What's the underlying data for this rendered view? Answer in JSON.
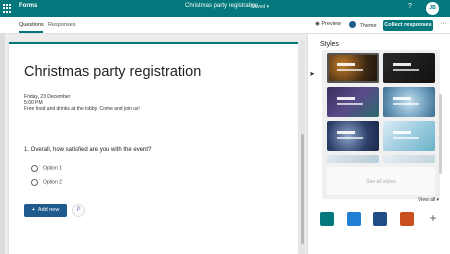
{
  "topbar": {
    "app_name": "Forms",
    "doc_title": "Christmas party registration",
    "saved": "Saved",
    "help": "?",
    "avatar": "JB",
    "color": "#03787c"
  },
  "cmdbar": {
    "tabs": [
      {
        "label": "Questions"
      },
      {
        "label": "Responses"
      }
    ],
    "preview": "Preview",
    "theme": "Theme",
    "collect": "Collect responses",
    "more": "···"
  },
  "form": {
    "title": "Christmas party registration",
    "date": "Friday, 23 December",
    "time": "5:00 PM",
    "description": "Free food and drinks at the lobby. Come and join us!",
    "question": "1. Overall, how satisfied are you with the event?",
    "options": [
      "Option 1",
      "Option 2"
    ],
    "add_new": "Add new"
  },
  "styles_panel": {
    "title": "Styles",
    "view_all": "View all",
    "see_all_button": "See all styles",
    "swatches": [
      "#03787c",
      "#1e7fd4",
      "#1f4f86",
      "#c9501c"
    ],
    "add_icon": "+"
  }
}
